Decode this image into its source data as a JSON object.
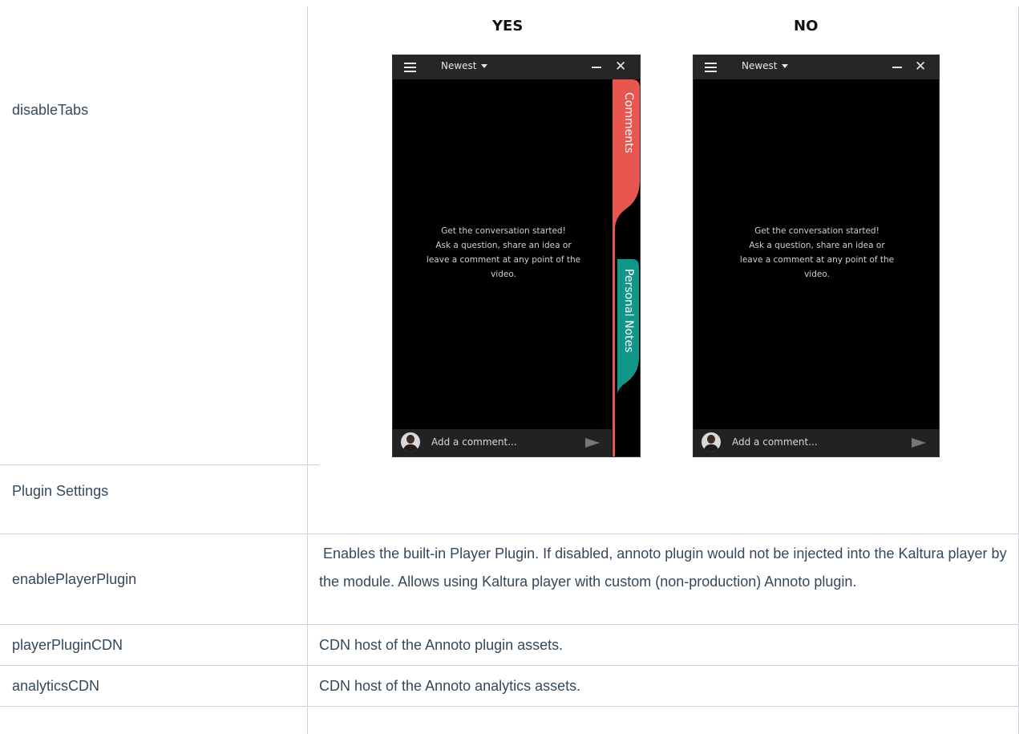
{
  "table": {
    "rows": [
      {
        "name": "disableTabs"
      },
      {
        "name": "Plugin Settings"
      },
      {
        "name": "enablePlayerPlugin",
        "description": " Enables the built-in Player Plugin. If disabled, annoto plugin would not be injected into the Kaltura player by the module. Allows using Kaltura player with custom (non-production) Annoto plugin."
      },
      {
        "name": "playerPluginCDN",
        "description": "CDN host of the Annoto plugin assets."
      },
      {
        "name": "analyticsCDN",
        "description": "CDN host of the Annoto analytics assets."
      }
    ]
  },
  "comparison": {
    "yes_label": "YES",
    "no_label": "NO"
  },
  "widget": {
    "sort_label": "Newest",
    "close_symbol": "✕",
    "message_line1": "Get the conversation started!",
    "message_line2": "Ask a question, share an idea or",
    "message_line3": "leave a comment at any point of the",
    "message_line4": "video.",
    "comment_placeholder": "Add a comment...",
    "tab_comments": "Comments",
    "tab_personal_notes": "Personal Notes",
    "tab_comments_color": "#e8574f",
    "tab_notes_color": "#12968a"
  }
}
